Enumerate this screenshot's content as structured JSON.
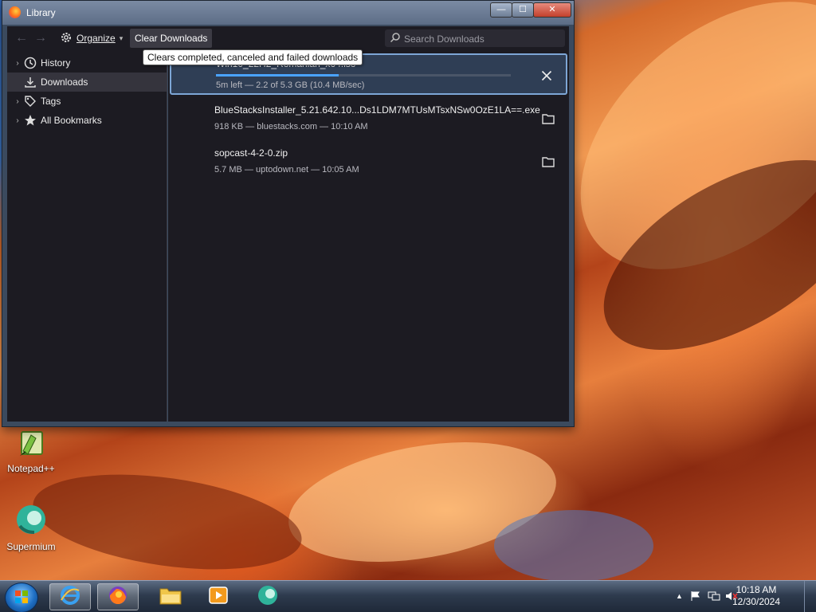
{
  "window": {
    "title": "Library",
    "min_glyph": "—",
    "max_glyph": "☐",
    "close_glyph": "✕"
  },
  "toolbar": {
    "back_glyph": "←",
    "forward_glyph": "→",
    "organize_label": "Organize",
    "organize_caret": "▾",
    "clear_label": "Clear Downloads",
    "search_placeholder": "Search Downloads"
  },
  "tooltip": "Clears completed, canceled and failed downloads",
  "sidebar": {
    "items": [
      {
        "label": "History",
        "expander": "›",
        "icon": "clock-icon"
      },
      {
        "label": "Downloads",
        "expander": "",
        "icon": "download-icon"
      },
      {
        "label": "Tags",
        "expander": "›",
        "icon": "tag-icon"
      },
      {
        "label": "All Bookmarks",
        "expander": "›",
        "icon": "star-icon"
      }
    ]
  },
  "downloads": [
    {
      "name": "Win10_22H2_Romanian_x64.iso",
      "status": "5m left — 2.2 of 5.3 GB (10.4 MB/sec)",
      "progress": 0.415,
      "action_icon": "cancel-x-icon",
      "selected": true
    },
    {
      "name": "BlueStacksInstaller_5.21.642.10...Ds1LDM7MTUsMTsxNSw0OzE1LA==.exe",
      "status": "918 KB — bluestacks.com — 10:10 AM",
      "action_icon": "folder-icon",
      "selected": false
    },
    {
      "name": "sopcast-4-2-0.zip",
      "status": "5.7 MB — uptodown.net — 10:05 AM",
      "action_icon": "folder-icon",
      "selected": false
    }
  ],
  "desktop_icons": [
    {
      "label": "Notepad++",
      "icon": "notepadpp-icon"
    },
    {
      "label": "Supermium",
      "icon": "supermium-icon"
    }
  ],
  "taskbar": {
    "apps": [
      "internet-explorer-icon",
      "firefox-icon",
      "file-explorer-icon",
      "media-player-icon",
      "supermium-icon"
    ],
    "tray_arrow": "▲",
    "time": "10:18 AM",
    "date": "12/30/2024"
  }
}
